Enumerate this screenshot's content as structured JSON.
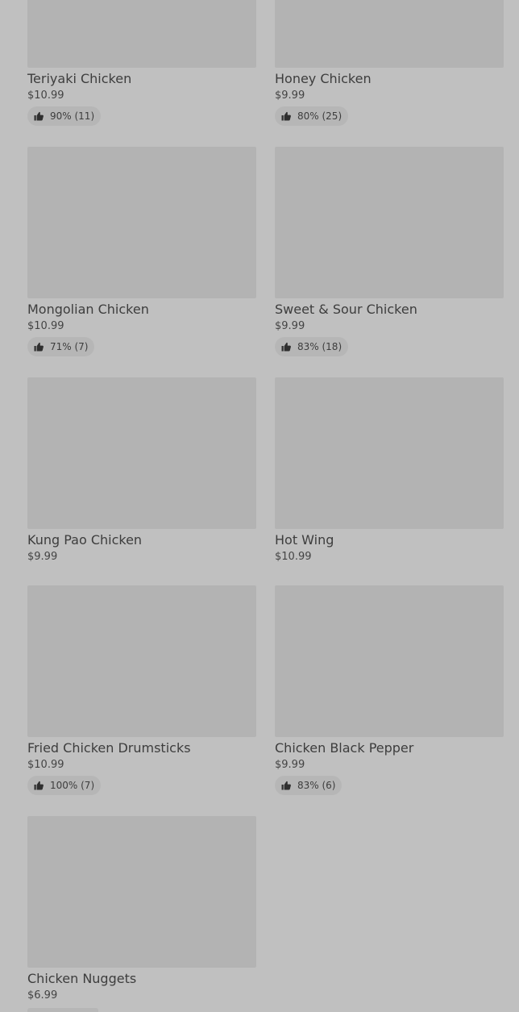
{
  "items": [
    {
      "name": "Teriyaki Chicken",
      "price": "$10.99",
      "rating": "90% (11)"
    },
    {
      "name": "Honey Chicken",
      "price": "$9.99",
      "rating": "80% (25)"
    },
    {
      "name": "Mongolian Chicken",
      "price": "$10.99",
      "rating": "71% (7)"
    },
    {
      "name": "Sweet & Sour Chicken",
      "price": "$9.99",
      "rating": "83% (18)"
    },
    {
      "name": "Kung Pao Chicken",
      "price": "$9.99"
    },
    {
      "name": "Hot Wing",
      "price": "$10.99"
    },
    {
      "name": "Fried Chicken Drumsticks",
      "price": "$10.99",
      "rating": "100% (7)"
    },
    {
      "name": "Chicken Black Pepper",
      "price": "$9.99",
      "rating": "83% (6)"
    },
    {
      "name": "Chicken Nuggets",
      "price": "$6.99",
      "rating": ""
    }
  ],
  "icons": {
    "rating": "thumbs-up-icon"
  }
}
